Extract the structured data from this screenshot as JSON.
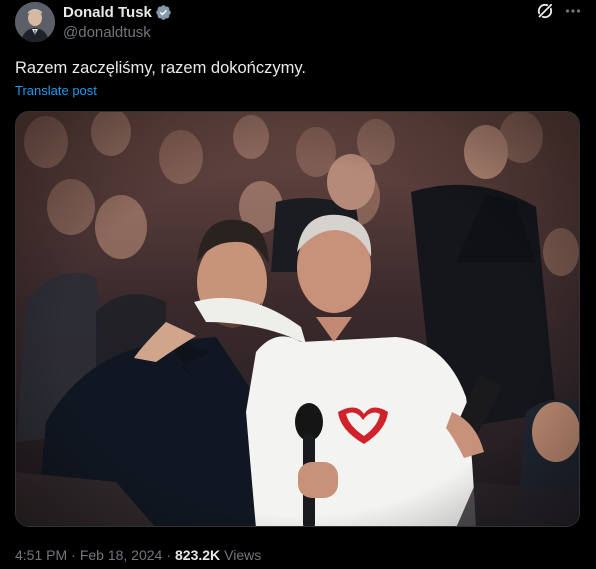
{
  "author": {
    "display_name": "Donald Tusk",
    "handle": "@donaldtusk",
    "verified": true
  },
  "icons": {
    "verified": "verified-badge-icon",
    "grok": "grok-icon",
    "more": "more-icon"
  },
  "post": {
    "text": "Razem zaczęliśmy, razem dokończymy.",
    "translate_label": "Translate post"
  },
  "meta": {
    "time": "4:51 PM",
    "separator": "·",
    "date": "Feb 18, 2024",
    "views_count": "823.2K",
    "views_label": "Views"
  },
  "colors": {
    "background": "#000000",
    "text_primary": "#e7e9ea",
    "text_secondary": "#71767b",
    "link": "#1d9bf0",
    "verified_badge": "#829aab",
    "border": "#2f3336"
  }
}
